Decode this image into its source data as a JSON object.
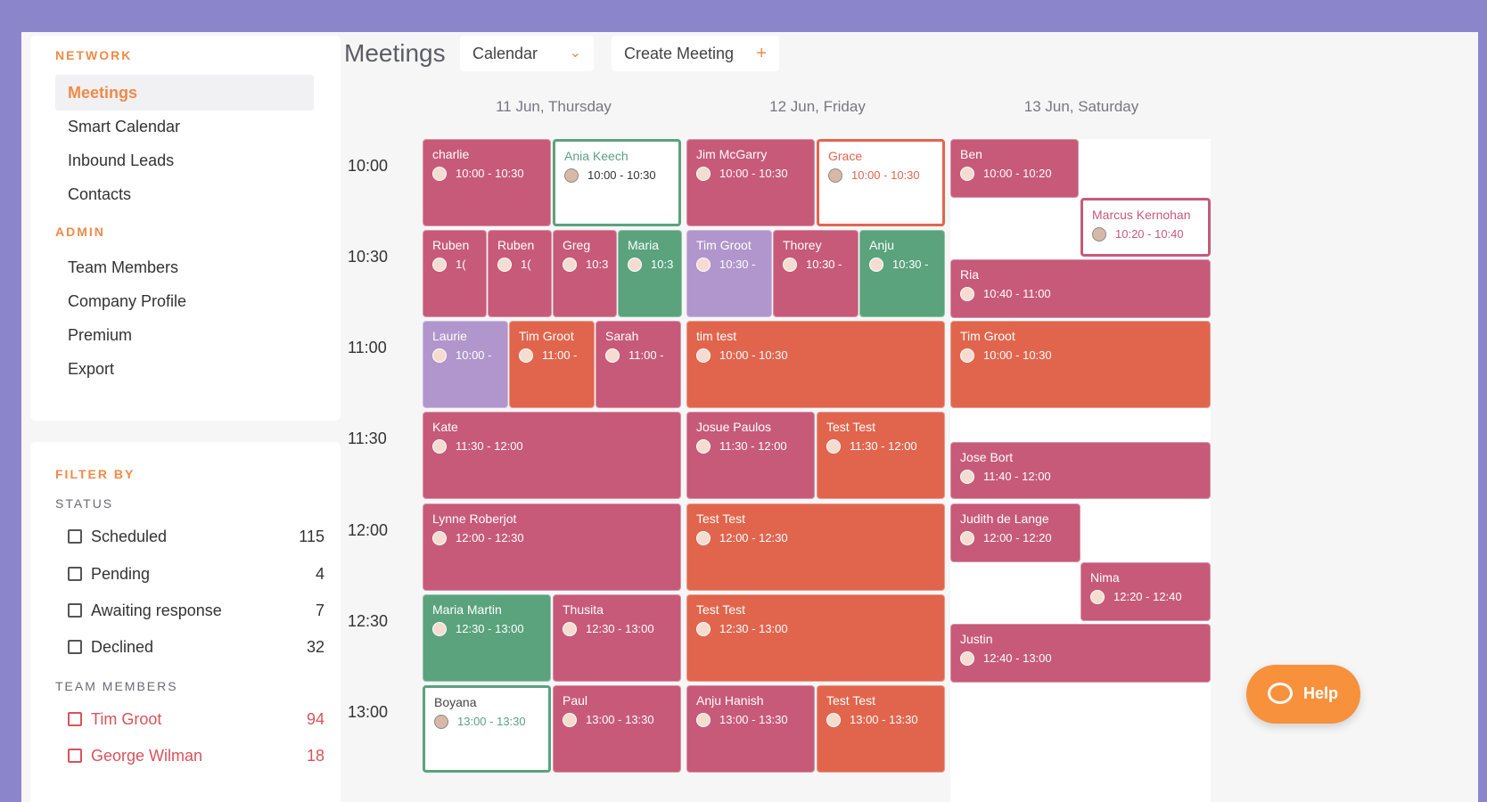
{
  "sidebar": {
    "network_label": "NETWORK",
    "network_items": [
      "Meetings",
      "Smart Calendar",
      "Inbound Leads",
      "Contacts"
    ],
    "admin_label": "ADMIN",
    "admin_items": [
      "Team Members",
      "Company Profile",
      "Premium",
      "Export"
    ],
    "filter_label": "FILTER BY",
    "status_label": "STATUS",
    "status_filters": [
      {
        "label": "Scheduled",
        "count": "115"
      },
      {
        "label": "Pending",
        "count": "4"
      },
      {
        "label": "Awaiting response",
        "count": "7"
      },
      {
        "label": "Declined",
        "count": "32"
      }
    ],
    "team_label": "TEAM MEMBERS",
    "team_filters": [
      {
        "label": "Tim Groot",
        "count": "94"
      },
      {
        "label": "George Wilman",
        "count": "18"
      }
    ]
  },
  "header": {
    "title": "Meetings",
    "view_select": "Calendar",
    "create_button": "Create Meeting"
  },
  "calendar": {
    "days": [
      "11 Jun, Thursday",
      "12 Jun, Friday",
      "13 Jun, Saturday"
    ],
    "times": [
      "10:00",
      "10:30",
      "11:00",
      "11:30",
      "12:00",
      "12:30",
      "13:00"
    ],
    "events": [
      {
        "name": "charlie",
        "time": "10:00 - 10:30"
      },
      {
        "name": "Ania Keech",
        "time": "10:00 - 10:30"
      },
      {
        "name": "Ruben",
        "time": "1("
      },
      {
        "name": "Ruben",
        "time": "1("
      },
      {
        "name": "Greg",
        "time": "10:3"
      },
      {
        "name": "Maria",
        "time": "10:3"
      },
      {
        "name": "Laurie",
        "time": "10:00 -"
      },
      {
        "name": "Tim Groot",
        "time": "11:00 -"
      },
      {
        "name": "Sarah",
        "time": "11:00 -"
      },
      {
        "name": "Kate",
        "time": "11:30 - 12:00"
      },
      {
        "name": "Lynne Roberjot",
        "time": "12:00 - 12:30"
      },
      {
        "name": "Maria Martin",
        "time": "12:30 - 13:00"
      },
      {
        "name": "Thusita",
        "time": "12:30 - 13:00"
      },
      {
        "name": "Boyana",
        "time": "13:00 - 13:30"
      },
      {
        "name": "Paul",
        "time": "13:00 - 13:30"
      },
      {
        "name": "Jim McGarry",
        "time": "10:00 - 10:30"
      },
      {
        "name": "Grace",
        "time": "10:00 - 10:30"
      },
      {
        "name": "Tim Groot",
        "time": "10:30 -"
      },
      {
        "name": "Thorey",
        "time": "10:30 -"
      },
      {
        "name": "Anju",
        "time": "10:30 -"
      },
      {
        "name": "tim test",
        "time": "10:00 - 10:30"
      },
      {
        "name": "Josue Paulos",
        "time": "11:30 - 12:00"
      },
      {
        "name": "Test Test",
        "time": "11:30 - 12:00"
      },
      {
        "name": "Test Test",
        "time": "12:00 - 12:30"
      },
      {
        "name": "Test Test",
        "time": "12:30 - 13:00"
      },
      {
        "name": "Anju Hanish",
        "time": "13:00 - 13:30"
      },
      {
        "name": "Test Test",
        "time": "13:00 - 13:30"
      },
      {
        "name": "Ben",
        "time": "10:00 - 10:20"
      },
      {
        "name": "Marcus Kernohan",
        "time": "10:20 - 10:40"
      },
      {
        "name": "Ria",
        "time": "10:40 - 11:00"
      },
      {
        "name": "Tim Groot",
        "time": "10:00 - 10:30"
      },
      {
        "name": "Jose Bort",
        "time": "11:40 - 12:00"
      },
      {
        "name": "Judith de Lange",
        "time": "12:00 - 12:20"
      },
      {
        "name": "Nima",
        "time": "12:20 - 12:40"
      },
      {
        "name": "Justin",
        "time": "12:40 - 13:00"
      }
    ]
  },
  "help_label": "Help",
  "colors": {
    "accent": "#f08a48",
    "pink": "#c75a79",
    "orange": "#e1654d",
    "green": "#5aa37d",
    "purple": "#b096cc"
  }
}
